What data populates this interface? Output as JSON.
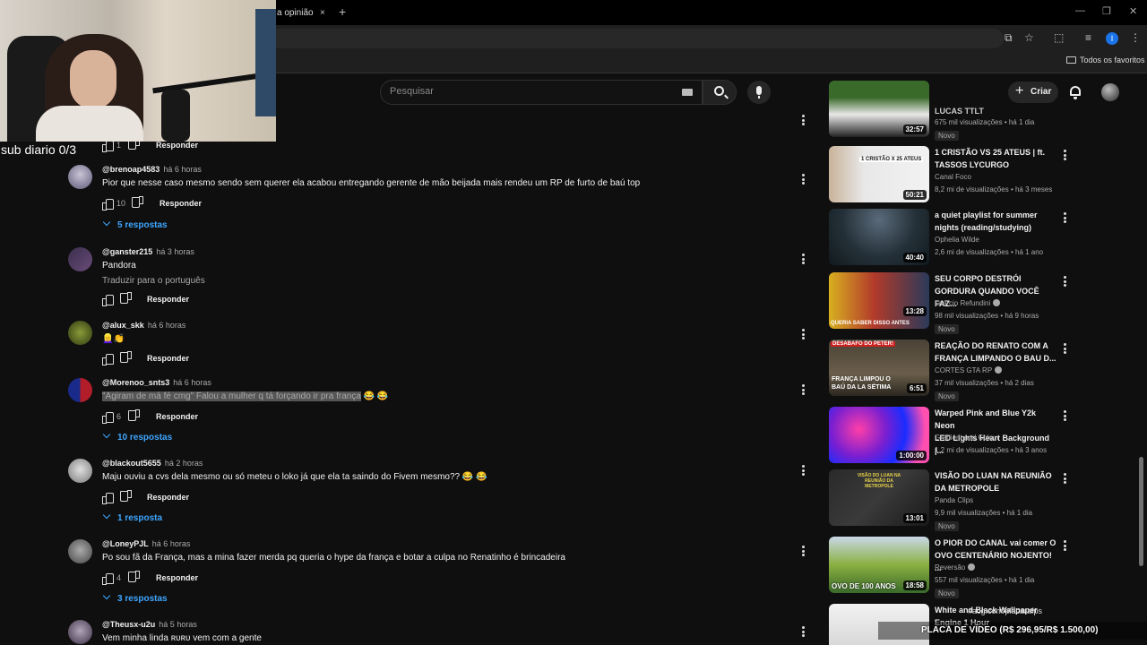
{
  "browser": {
    "tab_title": "a opinião",
    "tab_close": "×",
    "new_tab": "+",
    "bookmarks_folder": "Todos os favoritos",
    "profile_initial": "I"
  },
  "overlay": {
    "sub_counter": "sub diario 0/3",
    "ticker": "#acg.com/placarafps",
    "banner": "PLACA DE VÍDEO (R$ 296,95/R$ 1.500,00)"
  },
  "header": {
    "search_placeholder": "Pesquisar",
    "create_label": "Criar"
  },
  "comments": [
    {
      "author": "",
      "time": "",
      "text": "",
      "likes": "1",
      "reply_label": "Responder",
      "replies": ""
    },
    {
      "author": "@brenoap4583",
      "time": "há 6 horas",
      "text": "Pior que nesse caso mesmo sendo sem querer ela acabou entregando gerente de mão beijada mais rendeu um RP de furto de baú top",
      "likes": "10",
      "reply_label": "Responder",
      "replies": "5 respostas"
    },
    {
      "author": "@ganster215",
      "time": "há 3 horas",
      "text": "Pandora",
      "translate": "Traduzir para o português",
      "likes": "",
      "reply_label": "Responder",
      "replies": ""
    },
    {
      "author": "@alux_skk",
      "time": "há 6 horas",
      "text": "👱‍♀️👏",
      "likes": "",
      "reply_label": "Responder",
      "replies": ""
    },
    {
      "author": "@Morenoo_snts3",
      "time": "há 6 horas",
      "text_highlight": "\"Agiram de má fé cmg\" Falou a mulher q tá forçando ir pra frança",
      "text_tail": " 😂 😂",
      "likes": "6",
      "reply_label": "Responder",
      "replies": "10 respostas"
    },
    {
      "author": "@blackout5655",
      "time": "há 2 horas",
      "text": "Maju ouviu a cvs dela mesmo ou só meteu o loko já que ela ta saindo do Fivem mesmo?? 😂 😂",
      "likes": "",
      "reply_label": "Responder",
      "replies": "1 resposta"
    },
    {
      "author": "@LoneyPJL",
      "time": "há 6 horas",
      "text": "Po sou fã da França, mas a mina fazer merda pq queria o hype da frança e botar a culpa no Renatinho é brincadeira",
      "likes": "4",
      "reply_label": "Responder",
      "replies": "3 respostas"
    },
    {
      "author": "@Theusx-u2u",
      "time": "há 5 horas",
      "text": "Vem minha linda ʀᴜʀᴜ vem com a gente",
      "likes": "",
      "reply_label": "",
      "replies": ""
    }
  ],
  "videos": [
    {
      "title_lines": [
        "LUCAS TTLT"
      ],
      "channel": "",
      "views": "675 mil visualizações",
      "age": "há 1 dia",
      "badge": "Novo",
      "duration": "32:57"
    },
    {
      "title_lines": [
        "1 CRISTÃO VS 25 ATEUS | ft.",
        "TASSOS LYCURGO"
      ],
      "channel": "Canal Foco",
      "views": "8,2 mi de visualizações",
      "age": "há 3 meses",
      "badge": "",
      "duration": "50:21",
      "thumb_text": "1 CRISTÃO X 25 ATEUS"
    },
    {
      "title_lines": [
        "a quiet playlist for summer",
        "nights (reading/studying)"
      ],
      "channel": "Ophelia Wilde",
      "views": "2,6 mi de visualizações",
      "age": "há 1 ano",
      "badge": "",
      "duration": "40:40"
    },
    {
      "title_lines": [
        "SEU CORPO DESTRÓI",
        "GORDURA QUANDO VOCÊ FAZ..."
      ],
      "channel": "Laércio Refundini",
      "views": "98 mil visualizações",
      "age": "há 9 horas",
      "badge": "Novo",
      "duration": "13:28",
      "thumb_text": "QUERIA SABER DISSO ANTES"
    },
    {
      "title_lines": [
        "REAÇÃO DO RENATO COM A",
        "FRANÇA LIMPANDO O BAU D..."
      ],
      "channel": "CORTES GTA RP",
      "views": "37 mil visualizações",
      "age": "há 2 dias",
      "badge": "Novo",
      "duration": "6:51",
      "thumb_text": "FRANÇA LIMPOU O BAÚ DA LA SÉTIMA",
      "thumb_tag": "DESABAFO DO PETER!"
    },
    {
      "title_lines": [
        "Warped Pink and Blue Y2k Neon",
        "LED Lights Heart Background |..."
      ],
      "channel": "Gradient and Colour",
      "views": "1,2 mi de visualizações",
      "age": "há 3 anos",
      "badge": "",
      "duration": "1:00:00"
    },
    {
      "title_lines": [
        "VISÃO DO LUAN NA REUNIÃO",
        "DA METROPOLE"
      ],
      "channel": "Panda Clips",
      "views": "9,9 mil visualizações",
      "age": "há 1 dia",
      "badge": "Novo",
      "duration": "13:01",
      "thumb_text": "VISÃO DO LUAN NA REUNIÃO DA METROPOLE"
    },
    {
      "title_lines": [
        "O PIOR DO CANAL vai comer O",
        "OVO CENTENÁRIO NOJENTO! ..."
      ],
      "channel": "Reversão",
      "views": "557 mil visualizações",
      "age": "há 1 dia",
      "badge": "Novo",
      "duration": "18:58",
      "thumb_text": "OVO DE 100 ANOS"
    },
    {
      "title_lines": [
        "White and Black Wallpaper",
        "Engine 1 Hour"
      ],
      "channel": "",
      "views": "",
      "age": "",
      "badge": "",
      "duration": ""
    }
  ]
}
